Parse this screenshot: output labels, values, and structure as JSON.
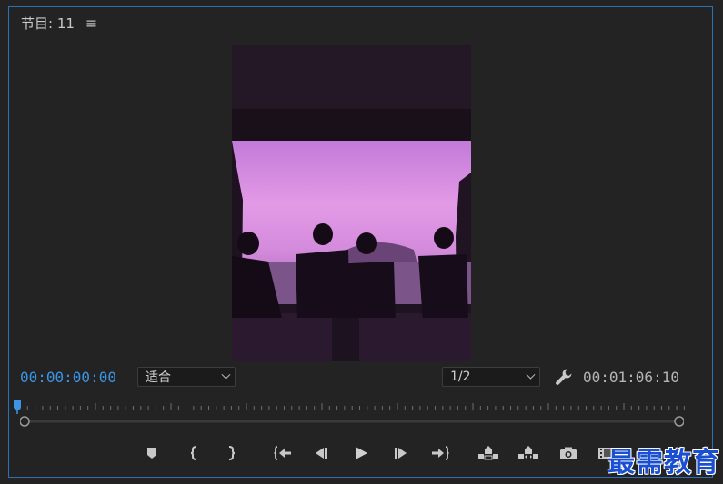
{
  "panel": {
    "title": "节目: 11",
    "menu_icon": "hamburger-icon",
    "border_color": "#2d6fb8"
  },
  "timecode": {
    "current": "00:00:00:00",
    "duration": "00:01:06:10",
    "current_color": "#3b94e6"
  },
  "fit_dropdown": {
    "selected": "适合"
  },
  "resolution_dropdown": {
    "selected": "1/2"
  },
  "controls": [
    {
      "name": "add-marker-button",
      "icon": "marker-icon"
    },
    {
      "name": "mark-in-button",
      "icon": "mark-in-icon"
    },
    {
      "name": "mark-out-button",
      "icon": "mark-out-icon"
    },
    {
      "name": "go-to-in-button",
      "icon": "go-to-in-icon"
    },
    {
      "name": "step-back-button",
      "icon": "step-back-icon"
    },
    {
      "name": "play-button",
      "icon": "play-icon"
    },
    {
      "name": "step-forward-button",
      "icon": "step-forward-icon"
    },
    {
      "name": "go-to-out-button",
      "icon": "go-to-out-icon"
    },
    {
      "name": "lift-button",
      "icon": "lift-icon"
    },
    {
      "name": "extract-button",
      "icon": "extract-icon"
    },
    {
      "name": "export-frame-button",
      "icon": "camera-icon"
    },
    {
      "name": "button-editor-button",
      "icon": "filmstrip-icon"
    }
  ],
  "watermark": {
    "text": "最需教育"
  }
}
